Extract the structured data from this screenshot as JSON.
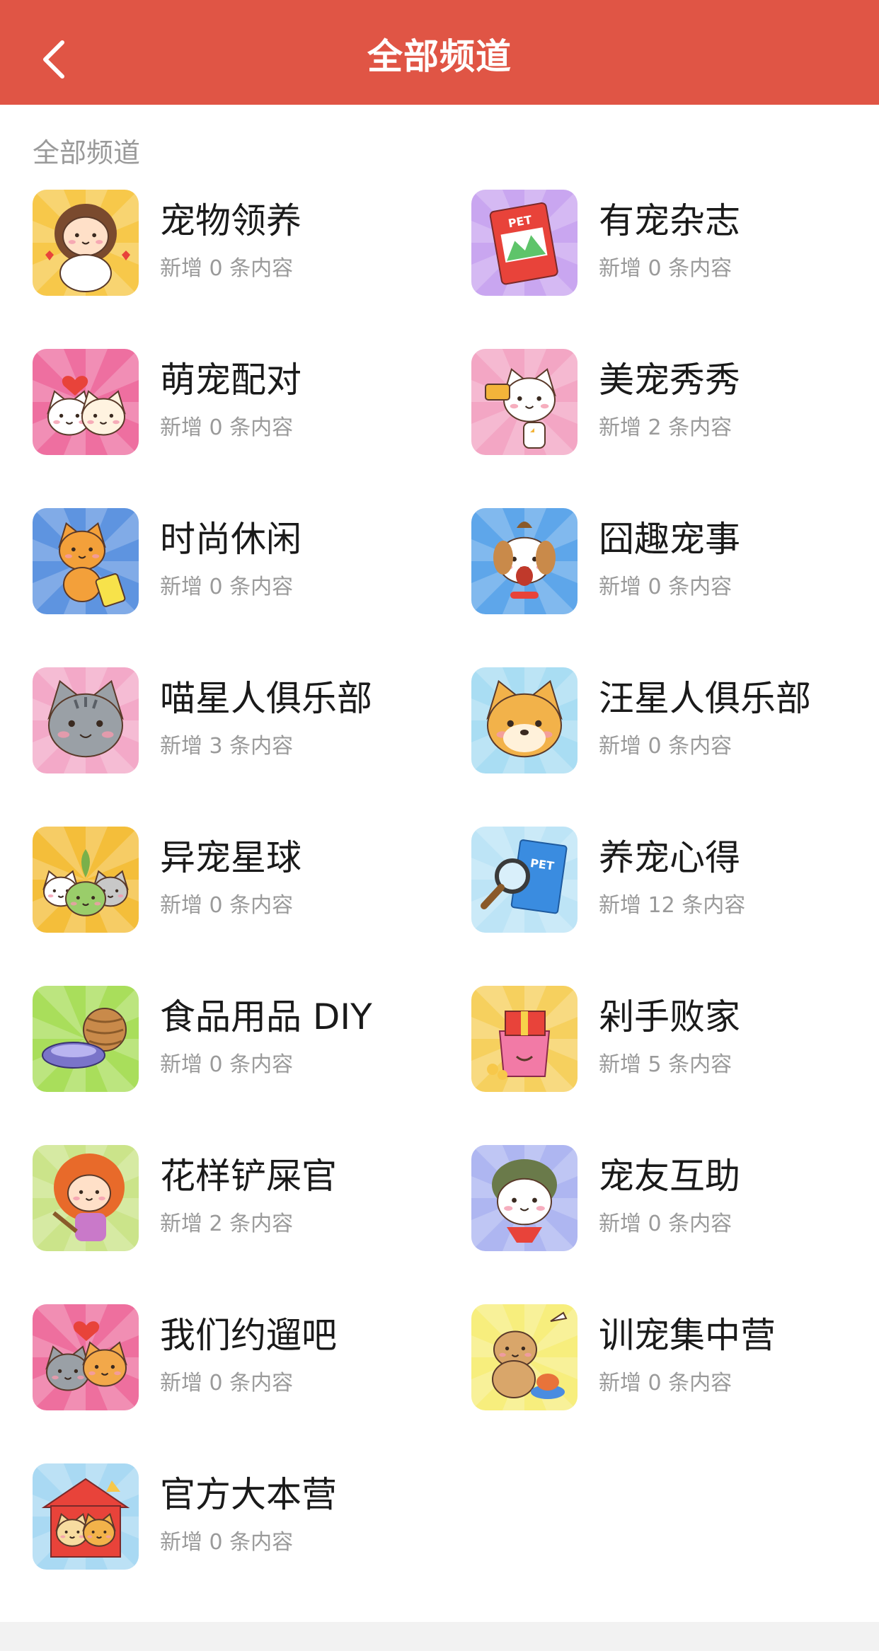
{
  "colors": {
    "navbar": "#E05545",
    "bottom": "#F2F2F2"
  },
  "header": {
    "back_icon": "chevron-left-icon",
    "title": "全部频道"
  },
  "section": {
    "title": "全部频道"
  },
  "channels": [
    {
      "name": "宠物领养",
      "update": "新增 0 条内容",
      "icon": "girl-holding-puppy-icon",
      "bg": "#F7C84A"
    },
    {
      "name": "有宠杂志",
      "update": "新增 0 条内容",
      "icon": "pet-magazine-icon",
      "bg": "#C9A6F0",
      "badge": "PET"
    },
    {
      "name": "萌宠配对",
      "update": "新增 0 条内容",
      "icon": "kissing-pets-icon",
      "bg": "#EE6FA0"
    },
    {
      "name": "美宠秀秀",
      "update": "新增 2 条内容",
      "icon": "dog-selfie-icon",
      "bg": "#F3A6C4"
    },
    {
      "name": "时尚休闲",
      "update": "新增 0 条内容",
      "icon": "cat-with-suitcase-icon",
      "bg": "#5E94E0"
    },
    {
      "name": "囧趣宠事",
      "update": "新增 0 条内容",
      "icon": "surprised-dog-icon",
      "bg": "#5EA6EA"
    },
    {
      "name": "喵星人俱乐部",
      "update": "新增 3 条内容",
      "icon": "grey-cat-face-icon",
      "bg": "#F3A9C8"
    },
    {
      "name": "汪星人俱乐部",
      "update": "新增 0 条内容",
      "icon": "shiba-face-icon",
      "bg": "#A9DDF3"
    },
    {
      "name": "异宠星球",
      "update": "新增 0 条内容",
      "icon": "exotic-pets-icon",
      "bg": "#F4BE3A"
    },
    {
      "name": "养宠心得",
      "update": "新增 12 条内容",
      "icon": "magnifier-book-icon",
      "bg": "#BDE4F6",
      "badge": "PET"
    },
    {
      "name": "食品用品 DIY",
      "update": "新增 0 条内容",
      "icon": "pet-bowl-yarn-icon",
      "bg": "#A9DE5B"
    },
    {
      "name": "剁手败家",
      "update": "新增 5 条内容",
      "icon": "gift-bag-icon",
      "bg": "#F6D05E"
    },
    {
      "name": "花样铲屎官",
      "update": "新增 2 条内容",
      "icon": "girl-with-scoop-icon",
      "bg": "#CBE48A"
    },
    {
      "name": "宠友互助",
      "update": "新增 0 条内容",
      "icon": "dog-with-scarf-icon",
      "bg": "#AEB6F1"
    },
    {
      "name": "我们约遛吧",
      "update": "新增 0 条内容",
      "icon": "cat-and-dog-hug-icon",
      "bg": "#EE6F9E"
    },
    {
      "name": "训宠集中营",
      "update": "新增 0 条内容",
      "icon": "dog-training-icon",
      "bg": "#F7EE7D"
    },
    {
      "name": "官方大本营",
      "update": "新增 0 条内容",
      "icon": "pets-in-house-icon",
      "bg": "#A9D9F3"
    }
  ]
}
